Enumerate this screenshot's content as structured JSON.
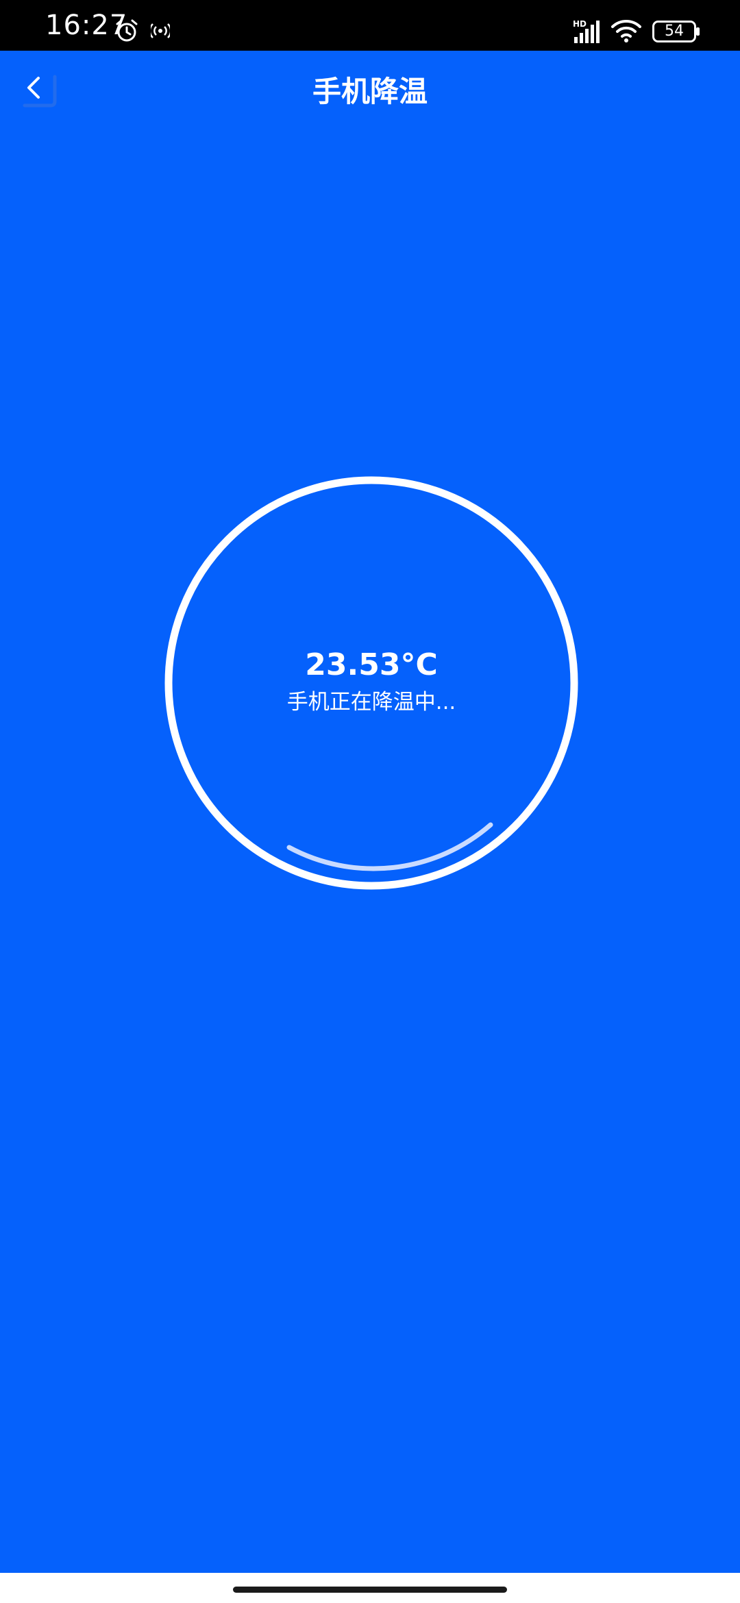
{
  "status_bar": {
    "time": "16:27",
    "battery_level": "54",
    "icons": [
      "alarm-icon",
      "hotspot-icon",
      "hd-signal-icon",
      "wifi-icon",
      "battery-icon"
    ]
  },
  "header": {
    "title": "手机降温",
    "back_icon": "chevron-left-icon"
  },
  "cooling": {
    "temperature": "23.53°C",
    "status_text": "手机正在降温中..."
  },
  "colors": {
    "background": "#0561fc",
    "status_bar": "#000000",
    "foreground": "#ffffff"
  }
}
